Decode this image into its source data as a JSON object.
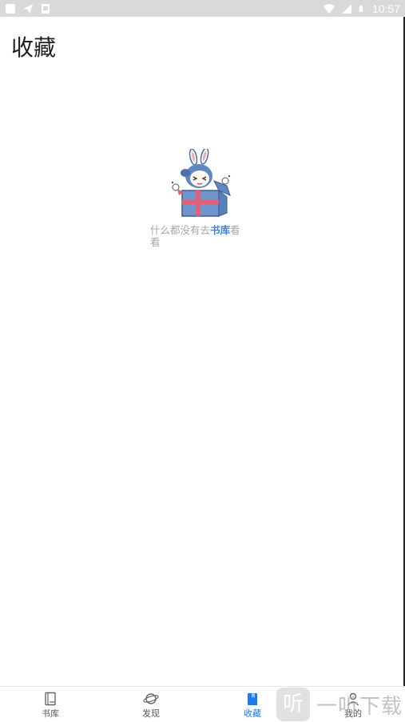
{
  "status_bar": {
    "time": "10:57",
    "left_icons": [
      "square-notification-icon",
      "send-notification-icon",
      "image-notification-icon"
    ],
    "right_icons": [
      "wifi-icon",
      "signal-icon",
      "battery-icon"
    ]
  },
  "header": {
    "title": "收藏"
  },
  "empty_state": {
    "illustration": "bunny-girl-in-gift-box-illustration",
    "text_before": "什么都没有去",
    "link_text": "书库",
    "text_after": "看看"
  },
  "tab_bar": {
    "active_tab": "收藏",
    "active_color": "#1a7ce8",
    "inactive_color": "#555555",
    "tabs": [
      {
        "label": "书库",
        "icon": "book-icon"
      },
      {
        "label": "发现",
        "icon": "planet-icon"
      },
      {
        "label": "收藏",
        "icon": "bookmark-book-icon"
      },
      {
        "label": "我的",
        "icon": "user-icon"
      }
    ]
  },
  "watermark": {
    "box_text": "听",
    "text": "一听下载"
  }
}
